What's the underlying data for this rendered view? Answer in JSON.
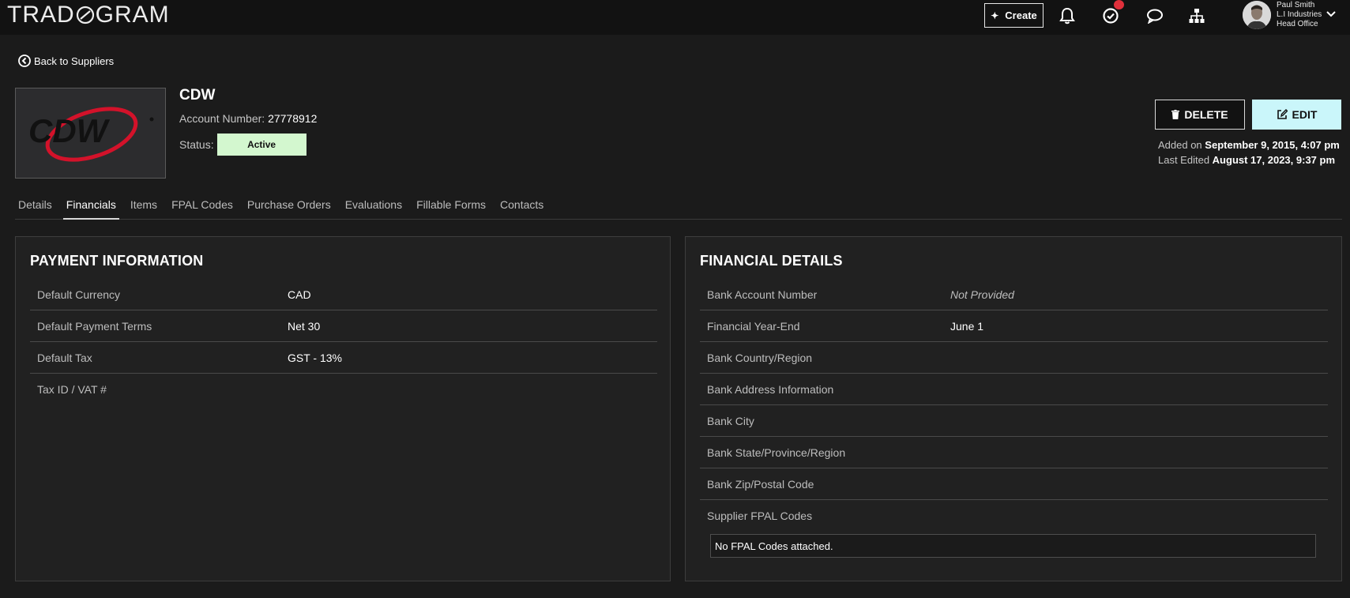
{
  "app": {
    "logo_left": "TRAD",
    "logo_right": "GRAM"
  },
  "topbar": {
    "create_label": "Create",
    "user": {
      "name": "Paul Smith",
      "company": "L.I Industries",
      "office": "Head Office"
    }
  },
  "back_link": "Back to Suppliers",
  "supplier": {
    "logo_text": "CDW",
    "name": "CDW",
    "account_label": "Account Number:",
    "account_number": "27778912",
    "status_label": "Status:",
    "status": "Active",
    "delete_label": "DELETE",
    "edit_label": "EDIT",
    "added_label": "Added on",
    "added_value": "September 9, 2015, 4:07 pm",
    "edited_label": "Last Edited",
    "edited_value": "August 17, 2023, 9:37 pm"
  },
  "tabs": [
    {
      "label": "Details",
      "active": false
    },
    {
      "label": "Financials",
      "active": true
    },
    {
      "label": "Items",
      "active": false
    },
    {
      "label": "FPAL Codes",
      "active": false
    },
    {
      "label": "Purchase Orders",
      "active": false
    },
    {
      "label": "Evaluations",
      "active": false
    },
    {
      "label": "Fillable Forms",
      "active": false
    },
    {
      "label": "Contacts",
      "active": false
    }
  ],
  "payment": {
    "title": "PAYMENT INFORMATION",
    "rows": [
      {
        "label": "Default Currency",
        "value": "CAD"
      },
      {
        "label": "Default Payment Terms",
        "value": "Net 30"
      },
      {
        "label": "Default Tax",
        "value": "GST - 13%"
      },
      {
        "label": "Tax ID / VAT #",
        "value": ""
      }
    ]
  },
  "financial": {
    "title": "FINANCIAL DETAILS",
    "rows": [
      {
        "label": "Bank Account Number",
        "value": "Not Provided"
      },
      {
        "label": "Financial Year-End",
        "value": "June 1"
      },
      {
        "label": "Bank Country/Region",
        "value": ""
      },
      {
        "label": "Bank Address Information",
        "value": ""
      },
      {
        "label": "Bank City",
        "value": ""
      },
      {
        "label": "Bank State/Province/Region",
        "value": ""
      },
      {
        "label": "Bank Zip/Postal Code",
        "value": ""
      },
      {
        "label": "Supplier FPAL Codes",
        "value": ""
      }
    ],
    "fpal_empty": "No FPAL Codes attached."
  },
  "colors": {
    "background": "#1b1b1b",
    "topbar": "#121212",
    "status_active_bg": "#d3f7cf",
    "edit_button_bg": "#caf6fa",
    "notification_badge": "#e0303b",
    "cdw_red": "#d3122a"
  },
  "icons": {
    "create": "plus-icon",
    "bell": "bell-icon",
    "tasks": "check-circle-icon",
    "chat": "chat-bubble-icon",
    "org": "org-chart-icon",
    "back": "arrow-left-circle-icon",
    "delete": "trash-icon",
    "edit": "edit-icon",
    "user_menu": "chevron-down-icon"
  }
}
